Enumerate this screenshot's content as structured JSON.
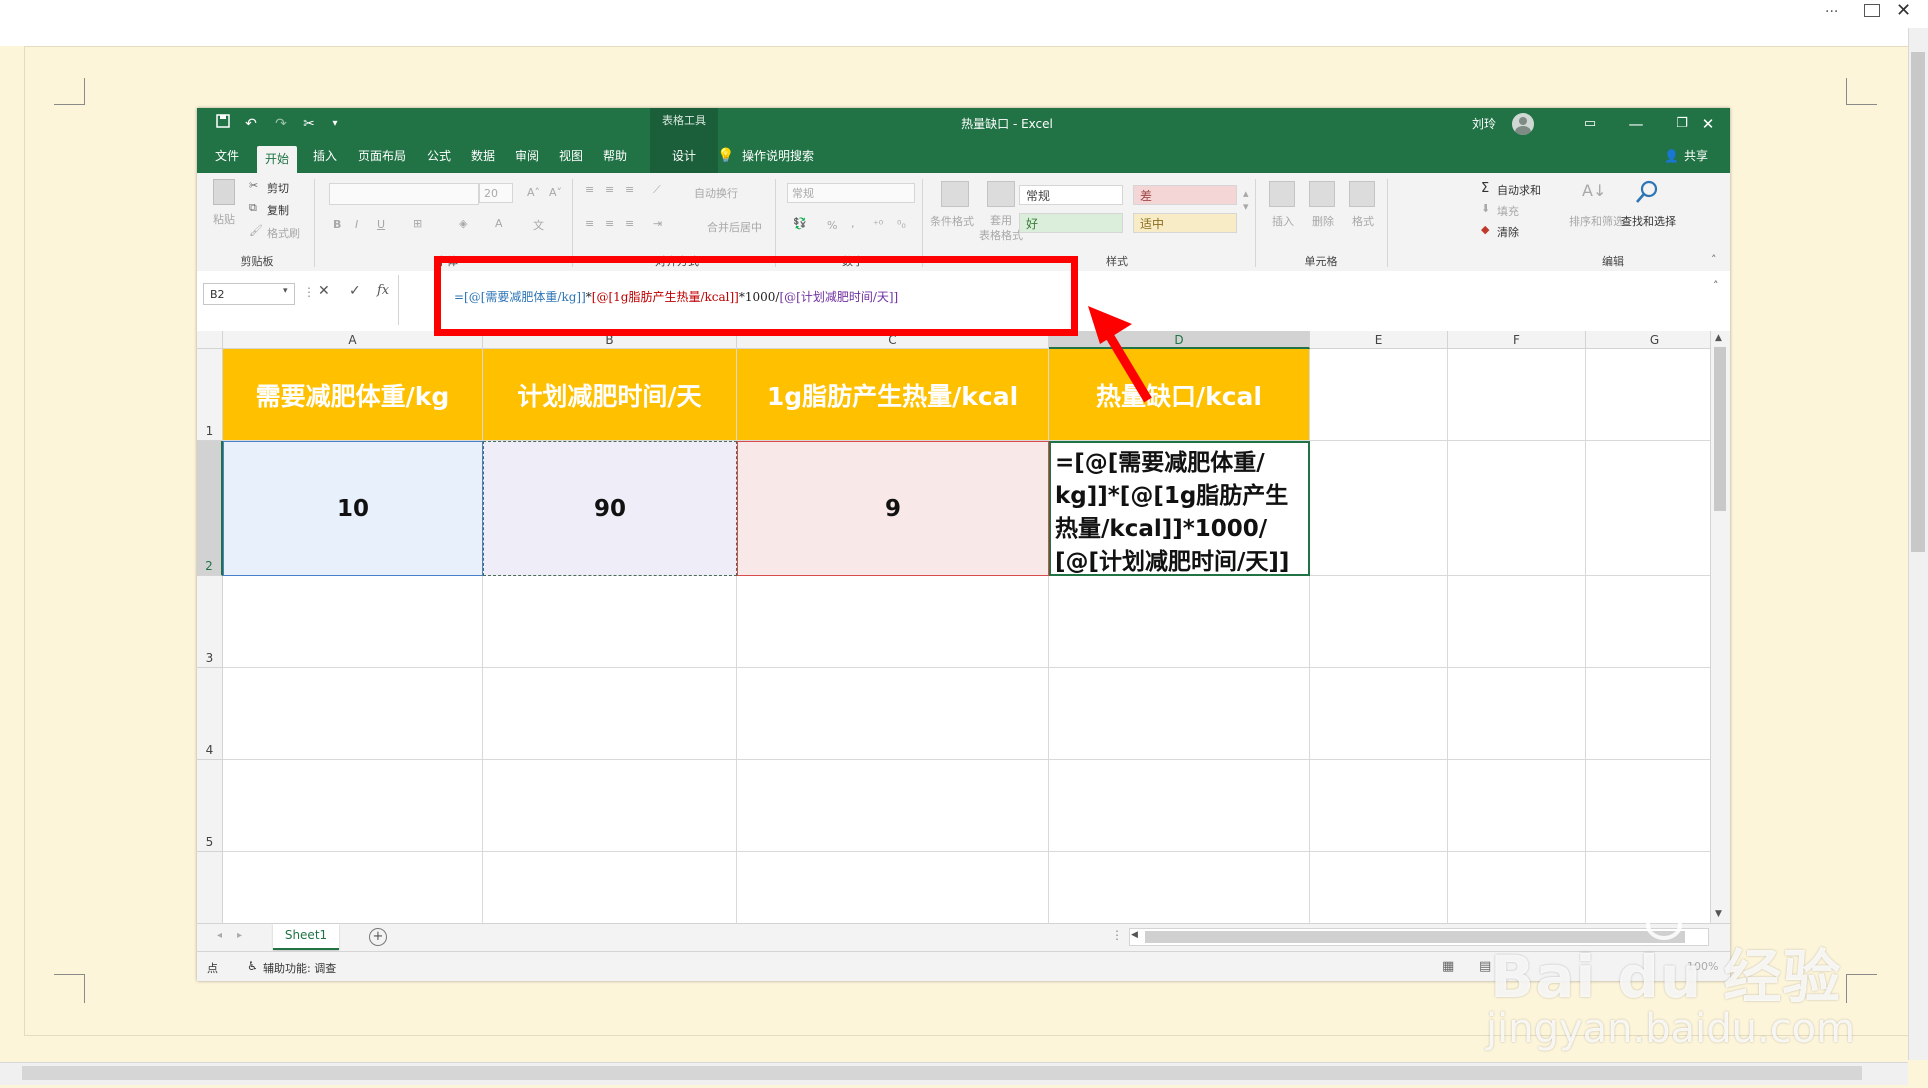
{
  "outer": {
    "menu_dots": "···"
  },
  "excel": {
    "title": "热量缺口 - Excel",
    "context_tab": "表格工具",
    "user_name": "刘玲",
    "tabs": [
      "文件",
      "开始",
      "插入",
      "页面布局",
      "公式",
      "数据",
      "审阅",
      "视图",
      "帮助",
      "设计"
    ],
    "tell_me": "操作说明搜索",
    "share": "共享",
    "ribbon": {
      "clipboard": {
        "paste": "粘贴",
        "cut": "剪切",
        "copy": "复制",
        "format_painter": "格式刷",
        "label": "剪贴板"
      },
      "font": {
        "size": "20",
        "label": "字体",
        "bold": "B",
        "italic": "I",
        "underline": "U"
      },
      "alignment": {
        "wrap": "自动换行",
        "merge": "合并后居中",
        "label": "对齐方式"
      },
      "number": {
        "format": "常规",
        "label": "数字",
        "percent": "%",
        "comma": ","
      },
      "styles": {
        "conditional": "条件格式",
        "table_format": "套用\n表格格式",
        "normal": "常规",
        "bad": "差",
        "good": "好",
        "neutral": "适中",
        "label": "样式"
      },
      "cells": {
        "insert": "插入",
        "delete": "删除",
        "format": "格式",
        "label": "单元格"
      },
      "editing": {
        "autosum": "自动求和",
        "fill": "填充",
        "clear": "清除",
        "sort": "排序和筛选",
        "find": "查找和选择",
        "label": "编辑"
      }
    },
    "formula_bar": {
      "name_box": "B2",
      "fx": "fx",
      "formula_parts": [
        {
          "text": "=[@[需要减肥体重/kg]]",
          "color": "#2e75b6"
        },
        {
          "text": "*",
          "color": "#222222"
        },
        {
          "text": "[@[1g脂肪产生热量/kcal]]",
          "color": "#c00000"
        },
        {
          "text": "*1000/",
          "color": "#222222"
        },
        {
          "text": "[@[计划减肥时间/天]]",
          "color": "#7030a0"
        }
      ]
    },
    "columns": [
      "A",
      "B",
      "C",
      "D",
      "E",
      "F",
      "G"
    ],
    "rows": [
      "1",
      "2",
      "3",
      "4",
      "5"
    ],
    "header_row": [
      "需要减肥体重/kg",
      "计划减肥时间/天",
      "1g脂肪产生热量/kcal",
      "热量缺口/kcal"
    ],
    "data_row": [
      "10",
      "90",
      "9"
    ],
    "d2_lines": [
      "=[@[需要减肥体重/",
      "kg]]*[@[1g脂肪产生",
      "热量/kcal]]*1000/",
      "[@[计划减肥时间/天]]"
    ],
    "sheet_tab": "Sheet1",
    "status": {
      "mode": "点",
      "accessibility": "辅助功能: 调查",
      "zoom": "100%"
    }
  },
  "watermark": {
    "logo": "Bai du 经验",
    "url": "jingyan.baidu.com"
  },
  "colors": {
    "excel_green": "#217346",
    "header_fill": "#ffc000",
    "a2_fill": "#e8f0fb",
    "b2_fill": "#efedf8",
    "c2_fill": "#f9e8e8",
    "annotation_red": "#ff0000"
  }
}
